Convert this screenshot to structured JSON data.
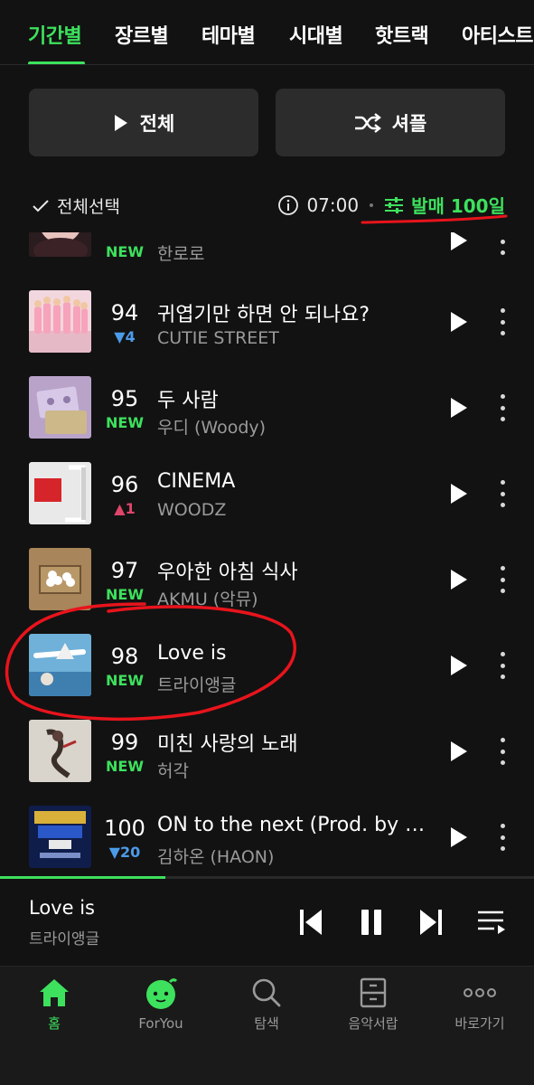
{
  "tabs": [
    {
      "label": "기간별",
      "active": true
    },
    {
      "label": "장르별"
    },
    {
      "label": "테마별"
    },
    {
      "label": "시대별"
    },
    {
      "label": "핫트랙"
    },
    {
      "label": "아티스트"
    }
  ],
  "actions": {
    "play_all": "전체",
    "shuffle": "셔플"
  },
  "toolbar": {
    "select_all": "전체선택",
    "time": "07:00",
    "filter": "발매 100일"
  },
  "tracks": [
    {
      "rank": "",
      "change": "NEW",
      "change_type": "new",
      "title": "",
      "artist": "한로로"
    },
    {
      "rank": "94",
      "change": "▼4",
      "change_type": "down",
      "title": "귀엽기만 하면 안 되나요?",
      "artist": "CUTIE STREET"
    },
    {
      "rank": "95",
      "change": "NEW",
      "change_type": "new",
      "title": "두 사람",
      "artist": "우디 (Woody)"
    },
    {
      "rank": "96",
      "change": "▲1",
      "change_type": "up",
      "title": "CINEMA",
      "artist": "WOODZ"
    },
    {
      "rank": "97",
      "change": "NEW",
      "change_type": "new",
      "title": "우아한 아침 식사",
      "artist": "AKMU (악뮤)"
    },
    {
      "rank": "98",
      "change": "NEW",
      "change_type": "new",
      "title": "Love is",
      "artist": "트라이앵글"
    },
    {
      "rank": "99",
      "change": "NEW",
      "change_type": "new",
      "title": "미친 사랑의 노래",
      "artist": "허각"
    },
    {
      "rank": "100",
      "change": "▼20",
      "change_type": "down",
      "title": "ON to the next (Prod. by C...",
      "artist": "김하온 (HAON)"
    }
  ],
  "now_playing": {
    "title": "Love is",
    "artist": "트라이앵글",
    "progress": 0.31
  },
  "bottom_nav": [
    {
      "label": "홈",
      "icon": "home-icon",
      "active": true
    },
    {
      "label": "ForYou",
      "icon": "foryou-mascot-icon"
    },
    {
      "label": "탐색",
      "icon": "search-icon"
    },
    {
      "label": "음악서랍",
      "icon": "drawer-icon"
    },
    {
      "label": "바로가기",
      "icon": "more-dots-icon"
    }
  ],
  "colors": {
    "accent": "#3de15d",
    "background": "#121212",
    "up": "#e0456a",
    "down": "#4c9be8",
    "annotation": "#e8141c"
  }
}
